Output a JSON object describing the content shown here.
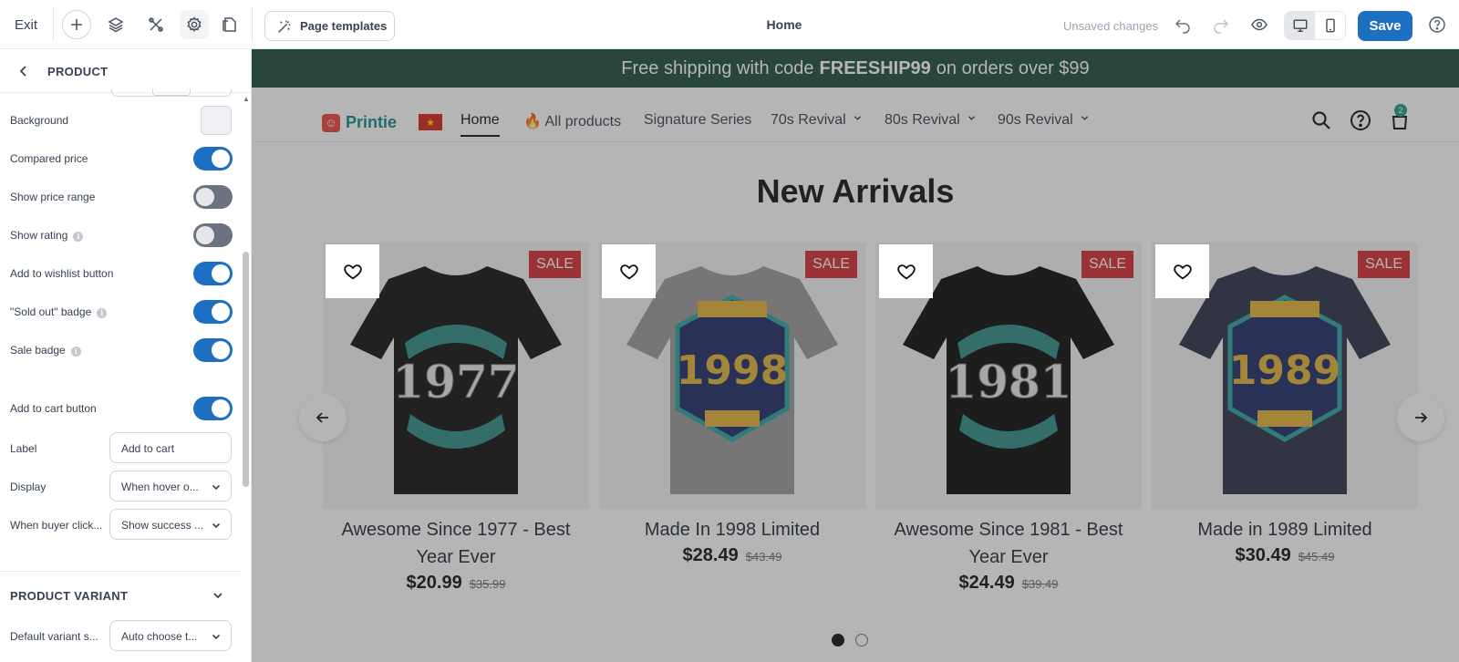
{
  "toolbar": {
    "exit_label": "Exit",
    "page_templates_label": "Page templates",
    "page_name": "Home",
    "unsaved_label": "Unsaved changes",
    "save_label": "Save"
  },
  "sidebar": {
    "title": "PRODUCT",
    "rows": {
      "background": "Background",
      "compared_price": "Compared price",
      "show_price_range": "Show price range",
      "show_rating": "Show rating",
      "add_to_wishlist": "Add to wishlist button",
      "sold_out_badge": "\"Sold out\" badge",
      "sale_badge": "Sale badge",
      "add_to_cart": "Add to cart button",
      "label": "Label",
      "label_value": "Add to cart",
      "display": "Display",
      "display_value": "When hover o...",
      "when_buyer_click": "When buyer click...",
      "when_buyer_click_value": "Show success ...",
      "default_variant": "Default variant s...",
      "default_variant_value": "Auto choose t..."
    },
    "toggles": {
      "compared_price": true,
      "show_price_range": false,
      "show_rating": false,
      "add_to_wishlist": true,
      "sold_out_badge": true,
      "sale_badge": true,
      "add_to_cart": true
    },
    "section_product_variant": "PRODUCT VARIANT"
  },
  "store": {
    "announcement": {
      "before": "Free shipping with code",
      "code": "FREESHIP99",
      "after": "on orders over $99"
    },
    "logo_mark": "☺",
    "logo_name": "Printie",
    "flag_star": "★",
    "nav": [
      "Home",
      "🔥 All products",
      "Signature Series",
      "70s Revival",
      "80s Revival",
      "90s Revival"
    ],
    "cart_count": "2",
    "section_heading": "New Arrivals",
    "sale_label": "SALE",
    "products": [
      {
        "title": "Awesome Since 1977 - Best Year Ever",
        "price": "$20.99",
        "compare": "$35.99",
        "year": "1977",
        "shirt_color": "#111111",
        "style": "awesome"
      },
      {
        "title": "Made In 1998 Limited",
        "price": "$28.49",
        "compare": "$43.49",
        "year": "1998",
        "shirt_color": "#9a9a9a",
        "style": "madein"
      },
      {
        "title": "Awesome Since 1981 - Best Year Ever",
        "price": "$24.49",
        "compare": "$39.49",
        "year": "1981",
        "shirt_color": "#0b0b0b",
        "style": "awesome"
      },
      {
        "title": "Made in 1989 Limited",
        "price": "$30.49",
        "compare": "$45.49",
        "year": "1989",
        "shirt_color": "#2a3047",
        "style": "madein"
      }
    ],
    "pagination_active": 1,
    "pagination_total": 2
  },
  "colors": {
    "primary": "#1d6fc2",
    "announcement_bg": "#1c4c3a",
    "sale_badge": "#d42c33",
    "logo_text": "#0e8b86",
    "cart_badge": "#16a085"
  }
}
